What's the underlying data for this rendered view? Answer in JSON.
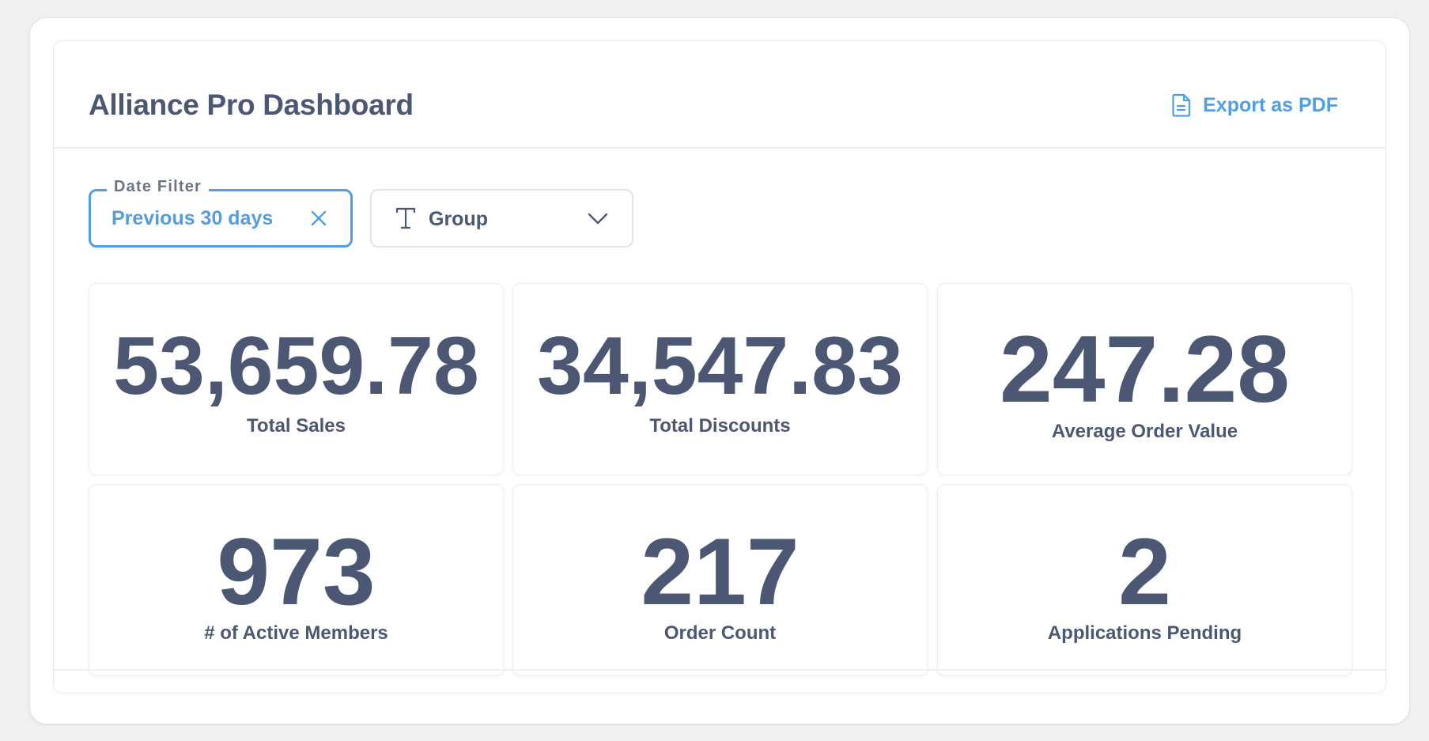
{
  "dashboard": {
    "title": "Alliance Pro Dashboard",
    "export_label": "Export as PDF"
  },
  "filters": {
    "date": {
      "legend": "Date Filter",
      "value": "Previous 30 days"
    },
    "group": {
      "label": "Group"
    }
  },
  "metrics": [
    {
      "value": "53,659.78",
      "label": "Total Sales"
    },
    {
      "value": "34,547.83",
      "label": "Total Discounts"
    },
    {
      "value": "247.28",
      "label": "Average Order Value"
    },
    {
      "value": "973",
      "label": "# of Active Members"
    },
    {
      "value": "217",
      "label": "Order Count"
    },
    {
      "value": "2",
      "label": "Applications Pending"
    }
  ],
  "colors": {
    "accent": "#509ee3",
    "text": "#4c5773",
    "muted": "#6b7488",
    "border": "#e2e4e8"
  },
  "icons": {
    "export": "document-icon",
    "clear": "close-icon",
    "group": "text-type-icon",
    "dropdown": "chevron-down-icon"
  }
}
